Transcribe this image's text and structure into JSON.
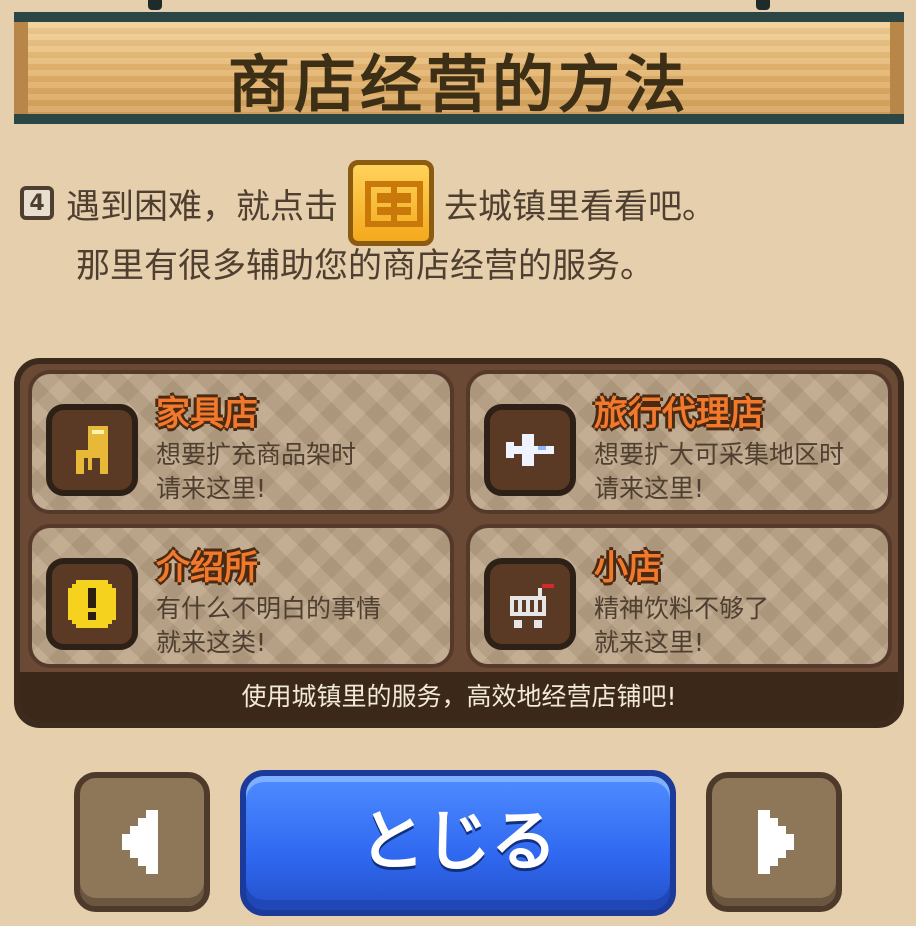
{
  "title": "商店经营的方法",
  "tip": {
    "page_number": "4",
    "line1_before": "遇到困难，就点击",
    "line1_after": "去城镇里看看吧。",
    "line2": "那里有很多辅助您的商店经营的服务。",
    "town_icon": "town-map-icon"
  },
  "services": [
    {
      "name": "家具店",
      "desc1": "想要扩充商品架时",
      "desc2": "请来这里!",
      "icon": "chair-icon"
    },
    {
      "name": "旅行代理店",
      "desc1": "想要扩大可采集地区时",
      "desc2": "请来这里!",
      "icon": "airplane-icon"
    },
    {
      "name": "介绍所",
      "desc1": "有什么不明白的事情",
      "desc2": "就来这类!",
      "icon": "exclamation-icon"
    },
    {
      "name": "小店",
      "desc1": "精神饮料不够了",
      "desc2": "就来这里!",
      "icon": "cart-icon"
    }
  ],
  "footer": "使用城镇里的服务，高效地经营店铺吧!",
  "buttons": {
    "close_label": "とじる",
    "prev_icon": "left-arrow-icon",
    "next_icon": "right-arrow-icon"
  },
  "colors": {
    "title_board": "#e4b36c",
    "service_name": "#f2792c",
    "close_button": "#2f68f0",
    "panel": "#6b4a35"
  }
}
